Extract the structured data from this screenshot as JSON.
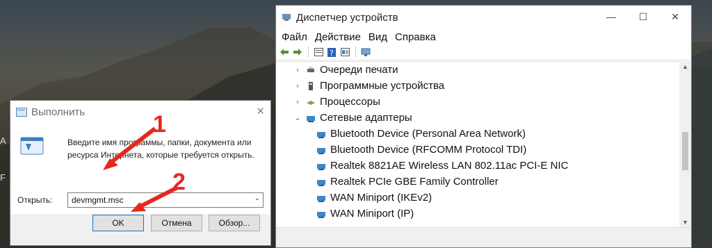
{
  "desktop": {
    "fragments": [
      "A",
      "F"
    ]
  },
  "device_manager": {
    "title": "Диспетчер устройств",
    "icon": "device-manager-icon",
    "menu": [
      "Файл",
      "Действие",
      "Вид",
      "Справка"
    ],
    "toolbar_icons": [
      "back-icon",
      "forward-icon",
      "properties-icon",
      "help-icon",
      "details-icon",
      "monitor-icon"
    ],
    "tree": [
      {
        "label": "Очереди печати",
        "icon": "printer-queue-icon",
        "expanded": false
      },
      {
        "label": "Программные устройства",
        "icon": "software-device-icon",
        "expanded": false
      },
      {
        "label": "Процессоры",
        "icon": "processor-icon",
        "expanded": false
      },
      {
        "label": "Сетевые адаптеры",
        "icon": "network-adapter-icon",
        "expanded": true,
        "children": [
          "Bluetooth Device (Personal Area Network)",
          "Bluetooth Device (RFCOMM Protocol TDI)",
          "Realtek 8821AE Wireless LAN 802.11ac PCI-E NIC",
          "Realtek PCIe GBE Family Controller",
          "WAN Miniport (IKEv2)",
          "WAN Miniport (IP)"
        ]
      }
    ]
  },
  "run_dialog": {
    "title": "Выполнить",
    "description": "Введите имя программы, папки, документа или ресурса Интернета, которые требуется открыть.",
    "open_label": "Открыть:",
    "input_value": "devmgmt.msc",
    "buttons": {
      "ok": "OK",
      "cancel": "Отмена",
      "browse": "Обзор..."
    }
  },
  "annotations": {
    "marker1": "1",
    "marker2": "2",
    "color": "#e5281f"
  }
}
